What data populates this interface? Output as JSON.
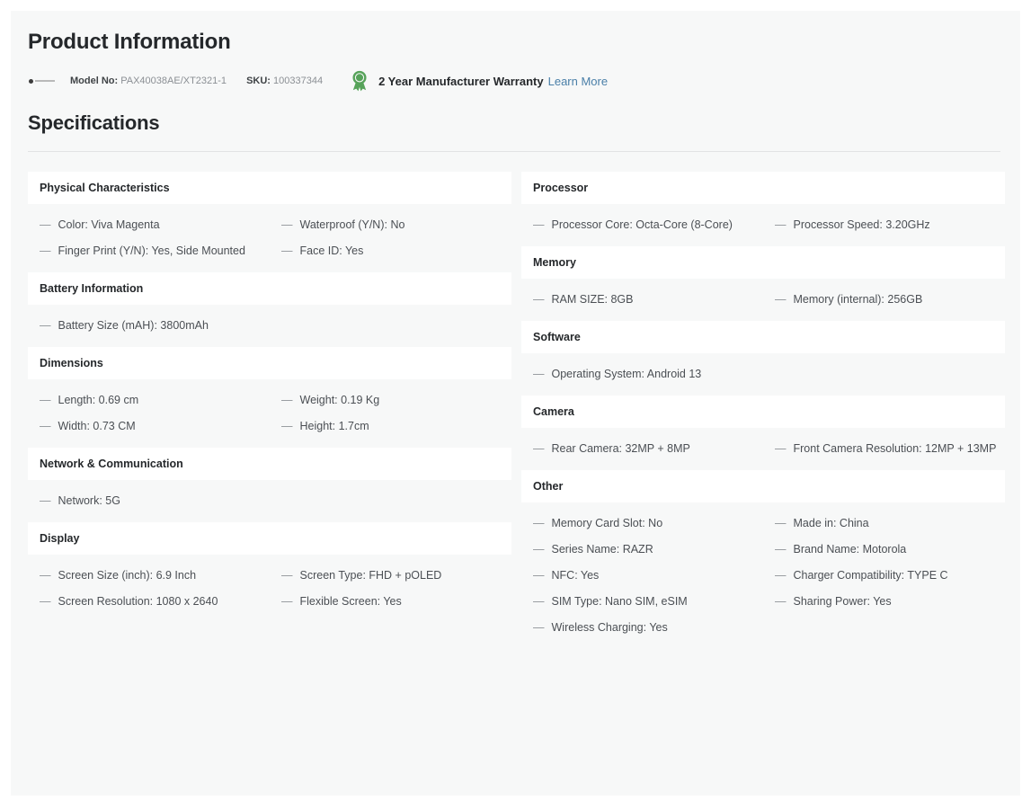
{
  "header": {
    "title": "Product Information",
    "model_label": "Model No:",
    "model_value": "PAX40038AE/XT2321-1",
    "sku_label": "SKU:",
    "sku_value": "100337344",
    "warranty_text": "2 Year Manufacturer Warranty",
    "warranty_link": "Learn More",
    "medal_color": "#57a35a",
    "link_color": "#4a7fa8"
  },
  "specifications": {
    "title": "Specifications",
    "left_sections": [
      {
        "heading": "Physical Characteristics",
        "rows": [
          "Color: Viva Magenta",
          "Waterproof (Y/N): No",
          "Finger Print (Y/N): Yes, Side Mounted",
          "Face ID: Yes"
        ]
      },
      {
        "heading": "Battery Information",
        "rows": [
          "Battery Size (mAH): 3800mAh"
        ]
      },
      {
        "heading": "Dimensions",
        "rows": [
          "Length: 0.69 cm",
          "Weight: 0.19 Kg",
          "Width: 0.73 CM",
          "Height: 1.7cm"
        ]
      },
      {
        "heading": "Network & Communication",
        "rows": [
          "Network: 5G"
        ]
      },
      {
        "heading": "Display",
        "rows": [
          "Screen Size (inch): 6.9 Inch",
          "Screen Type: FHD + pOLED",
          "Screen Resolution: 1080 x 2640",
          "Flexible Screen: Yes"
        ]
      }
    ],
    "right_sections": [
      {
        "heading": "Processor",
        "rows": [
          "Processor Core: Octa-Core (8-Core)",
          "Processor Speed: 3.20GHz"
        ]
      },
      {
        "heading": "Memory",
        "rows": [
          "RAM SIZE: 8GB",
          "Memory (internal): 256GB"
        ]
      },
      {
        "heading": "Software",
        "rows": [
          "Operating System: Android 13"
        ]
      },
      {
        "heading": "Camera",
        "rows": [
          "Rear Camera: 32MP + 8MP",
          "Front Camera Resolution: 12MP + 13MP"
        ]
      },
      {
        "heading": "Other",
        "rows": [
          "Memory Card Slot: No",
          "Made in: China",
          "Series Name: RAZR",
          "Brand Name: Motorola",
          "NFC: Yes",
          "Charger Compatibility: TYPE C",
          "SIM Type: Nano SIM, eSIM",
          "Sharing Power: Yes",
          "Wireless Charging: Yes"
        ]
      }
    ],
    "bullet_glyph": "—"
  }
}
